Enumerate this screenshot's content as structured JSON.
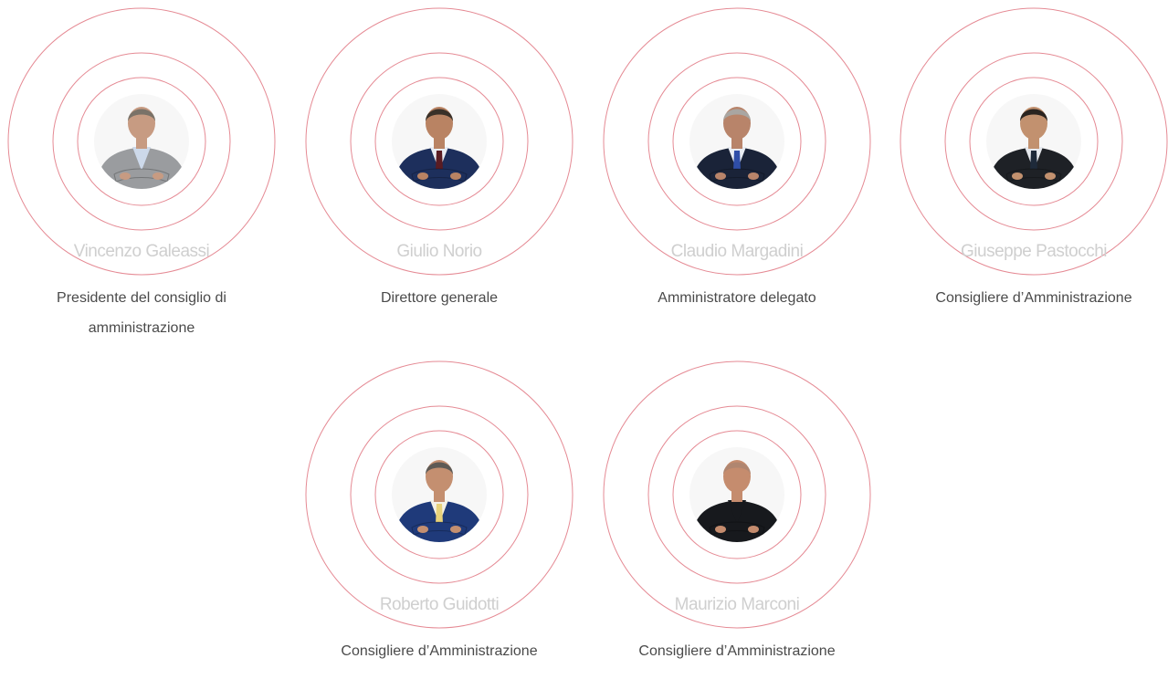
{
  "members": [
    {
      "name": "Vincenzo Galeassi",
      "role": "Presidente del consiglio di amministrazione",
      "jacket_color": "#9a9c9f",
      "shirt_color": "#cdd9ea",
      "tie_color": "",
      "hair_color": "#7a7268",
      "skin_color": "#c79b82"
    },
    {
      "name": "Giulio Norio",
      "role": "Direttore generale",
      "jacket_color": "#1d2f5c",
      "shirt_color": "#e8ecf2",
      "tie_color": "#5a1c22",
      "hair_color": "#3a3129",
      "skin_color": "#b98363"
    },
    {
      "name": "Claudio Margadini",
      "role": "Amministratore delegato",
      "jacket_color": "#1a2338",
      "shirt_color": "#e9edf3",
      "tie_color": "#2f4ea8",
      "hair_color": "#a9a6a2",
      "skin_color": "#b8846a"
    },
    {
      "name": "Giuseppe Pastocchi",
      "role": "Consigliere d’Amministrazione",
      "jacket_color": "#1e2126",
      "shirt_color": "#e6e9ee",
      "tie_color": "#1e2a3a",
      "hair_color": "#2a2420",
      "skin_color": "#c2916f"
    },
    {
      "name": "Roberto Guidotti",
      "role": "Consigliere d’Amministrazione",
      "jacket_color": "#1f3a7a",
      "shirt_color": "#f4f1e6",
      "tie_color": "#e8d27a",
      "hair_color": "#5e5a55",
      "skin_color": "#c48f70"
    },
    {
      "name": "Maurizio Marconi",
      "role": "Consigliere d’Amministrazione",
      "jacket_color": "#17191d",
      "shirt_color": "#17191d",
      "tie_color": "",
      "hair_color": "#b08670",
      "skin_color": "#c58c6e"
    }
  ],
  "ring_color": "#e58a94"
}
